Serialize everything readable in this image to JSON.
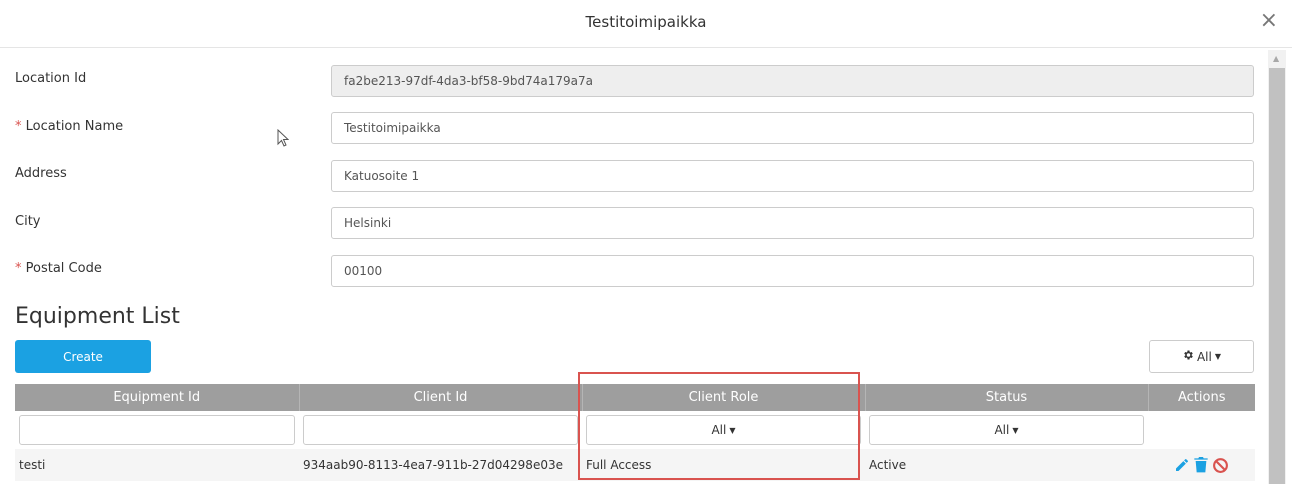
{
  "modal": {
    "title": "Testitoimipaikka",
    "close_label": "×"
  },
  "form": {
    "location_id": {
      "label": "Location Id",
      "value": "fa2be213-97df-4da3-bf58-9bd74a179a7a"
    },
    "location_name": {
      "required_mark": "*",
      "label": "Location Name",
      "value": "Testitoimipaikka"
    },
    "address": {
      "label": "Address",
      "value": "Katuosoite 1"
    },
    "city": {
      "label": "City",
      "value": "Helsinki"
    },
    "postal_code": {
      "required_mark": "*",
      "label": "Postal Code",
      "value": "00100"
    }
  },
  "equipment": {
    "title": "Equipment List",
    "create_label": "Create",
    "columns_button_label": "All",
    "headers": [
      "Equipment Id",
      "Client Id",
      "Client Role",
      "Status",
      "Actions"
    ],
    "filters": {
      "client_role": "All",
      "status": "All"
    },
    "rows": [
      {
        "equipment_id": "testi",
        "client_id": "934aab90-8113-4ea7-911b-27d04298e03e",
        "client_role": "Full Access",
        "status": "Active"
      }
    ]
  },
  "colors": {
    "primary": "#1ba1e2",
    "header_bg": "#9e9e9e",
    "highlight": "#d9534f",
    "edit_icon": "#1ba1e2",
    "delete_icon": "#1ba1e2",
    "disable_icon": "#d9534f"
  },
  "icons": [
    "close-icon",
    "gear-icon",
    "caret-down-icon",
    "pencil-icon",
    "trash-icon",
    "ban-icon",
    "scroll-up-icon"
  ]
}
